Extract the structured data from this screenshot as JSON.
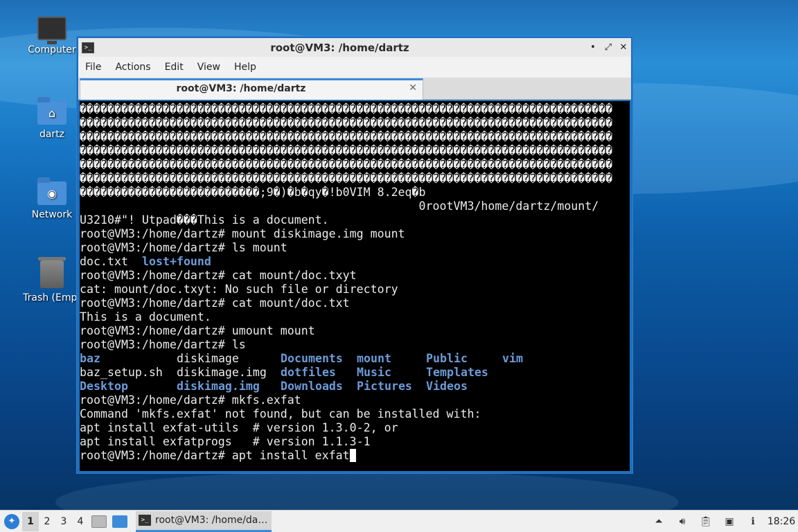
{
  "desktop": {
    "icons": [
      {
        "label": "Computer",
        "icon": "computer-icon"
      },
      {
        "label": "dartz",
        "icon": "home-folder-icon"
      },
      {
        "label": "Network",
        "icon": "network-folder-icon"
      },
      {
        "label": "Trash (Empt",
        "icon": "trash-icon"
      }
    ]
  },
  "window": {
    "title": "root@VM3: /home/dartz",
    "controls": {
      "minimize": "•",
      "maximize": "⤢",
      "close": "✕"
    },
    "menu": [
      "File",
      "Actions",
      "Edit",
      "View",
      "Help"
    ],
    "tab": {
      "title": "root@VM3: /home/dartz",
      "close": "✕"
    }
  },
  "terminal": {
    "lines_before": [
      "�����������������������������������������������������������������������������",
      "�����������������������������������������������������������������������������",
      "�����������������������������������������������������������������������������",
      "�����������������������������������������������������������������������������",
      "�����������������������������������������������������������������������������",
      "�����������������������������������������������������������������������������",
      "��������������������������;9�)�b�qy�!b0VIM 8.2eq�b",
      "                                                 0rootVM3/home/dartz/mount/",
      "U3210#\"! Utpad���This is a document.",
      "root@VM3:/home/dartz# mount diskimage.img mount",
      "root@VM3:/home/dartz# ls mount"
    ],
    "ls_mount": [
      {
        "name": "doc.txt",
        "type": "file"
      },
      {
        "name": "lost+found",
        "type": "dir"
      }
    ],
    "lines_middle": [
      "root@VM3:/home/dartz# cat mount/doc.txyt",
      "cat: mount/doc.txyt: No such file or directory",
      "root@VM3:/home/dartz# cat mount/doc.txt",
      "This is a document.",
      "root@VM3:/home/dartz# umount mount",
      "root@VM3:/home/dartz# ls"
    ],
    "ls_home": [
      [
        {
          "name": "baz",
          "type": "dir"
        },
        {
          "name": "diskimage",
          "type": "file"
        },
        {
          "name": "Documents",
          "type": "dir"
        },
        {
          "name": "mount",
          "type": "dir"
        },
        {
          "name": "Public",
          "type": "dir"
        },
        {
          "name": "vim",
          "type": "dir"
        }
      ],
      [
        {
          "name": "baz_setup.sh",
          "type": "file"
        },
        {
          "name": "diskimage.img",
          "type": "file"
        },
        {
          "name": "dotfiles",
          "type": "dir"
        },
        {
          "name": "Music",
          "type": "dir"
        },
        {
          "name": "Templates",
          "type": "dir"
        },
        {
          "name": "",
          "type": "file"
        }
      ],
      [
        {
          "name": "Desktop",
          "type": "dir"
        },
        {
          "name": "diskimag.img",
          "type": "dir"
        },
        {
          "name": "Downloads",
          "type": "dir"
        },
        {
          "name": "Pictures",
          "type": "dir"
        },
        {
          "name": "Videos",
          "type": "dir"
        },
        {
          "name": "",
          "type": "file"
        }
      ]
    ],
    "lines_after": [
      "root@VM3:/home/dartz# mkfs.exfat",
      "Command 'mkfs.exfat' not found, but can be installed with:",
      "apt install exfat-utils  # version 1.3.0-2, or",
      "apt install exfatprogs   # version 1.1.3-1"
    ],
    "prompt": "root@VM3:/home/dartz# apt install exfat"
  },
  "taskbar": {
    "workspaces": [
      "1",
      "2",
      "3",
      "4"
    ],
    "active_workspace": "1",
    "task_label": "root@VM3: /home/da…",
    "clock": "18:26"
  },
  "colors": {
    "terminal_bg": "#000000",
    "terminal_fg": "#ececec",
    "dir_color": "#6d9bd8",
    "accent": "#3c8bd8"
  }
}
